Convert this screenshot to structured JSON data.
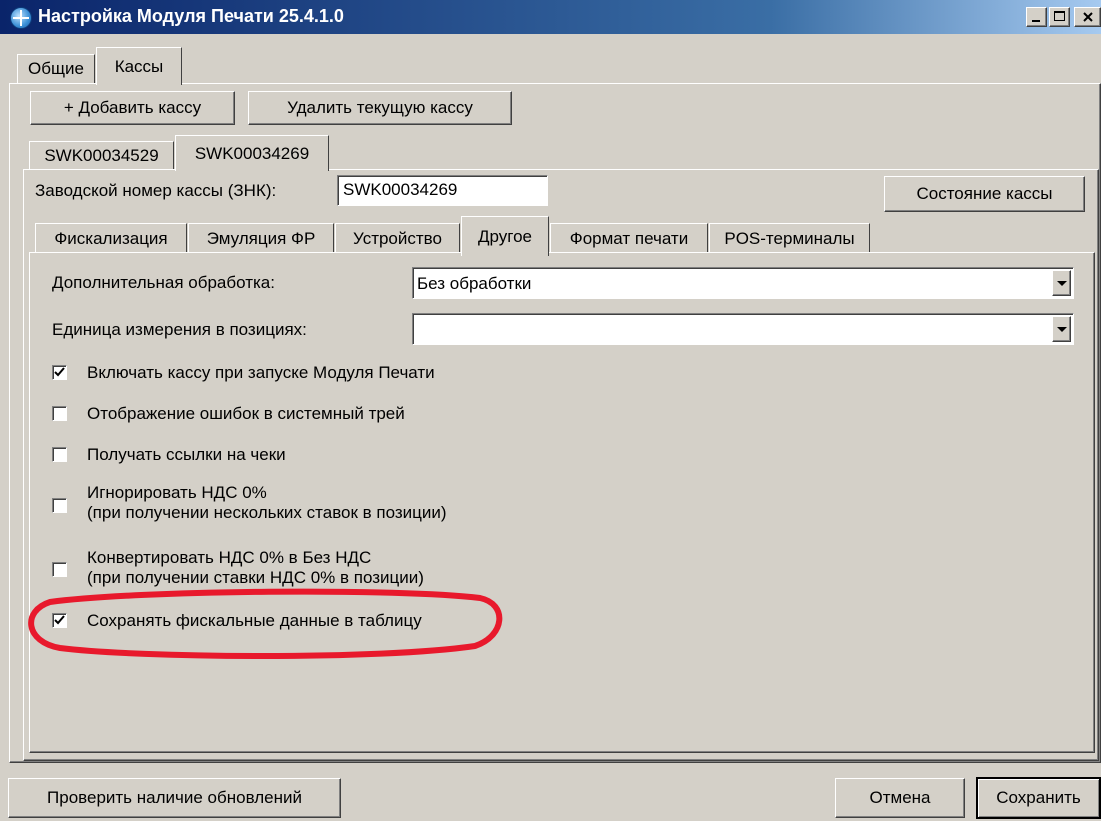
{
  "window": {
    "title": "Настройка Модуля Печати 25.4.1.0",
    "icon": "app-globe-icon"
  },
  "top_tabs": [
    {
      "label": "Общие",
      "selected": false
    },
    {
      "label": "Кассы",
      "selected": true
    }
  ],
  "toolbar": {
    "add_label": "+ Добавить кассу",
    "delete_label": "Удалить текущую кассу"
  },
  "register_tabs": [
    {
      "label": "SWK00034529",
      "selected": false
    },
    {
      "label": "SWK00034269",
      "selected": true
    }
  ],
  "serial": {
    "label": "Заводской номер кассы (ЗНК):",
    "value": "SWK00034269",
    "status_button": "Состояние кассы"
  },
  "settings_tabs": [
    {
      "label": "Фискализация",
      "selected": false
    },
    {
      "label": "Эмуляция ФР",
      "selected": false
    },
    {
      "label": "Устройство",
      "selected": false
    },
    {
      "label": "Другое",
      "selected": true
    },
    {
      "label": "Формат печати",
      "selected": false
    },
    {
      "label": "POS-терминалы",
      "selected": false
    }
  ],
  "other": {
    "processing_label": "Дополнительная обработка:",
    "processing_value": "Без обработки",
    "unit_label": "Единица измерения в позициях:",
    "unit_value": "",
    "checkboxes": [
      {
        "line1": "Включать кассу при запуске Модуля Печати",
        "line2": "",
        "checked": true
      },
      {
        "line1": "Отображение ошибок в системный трей",
        "line2": "",
        "checked": false
      },
      {
        "line1": "Получать ссылки на чеки",
        "line2": "",
        "checked": false
      },
      {
        "line1": "Игнорировать НДС 0%",
        "line2": "(при получении нескольких ставок в позиции)",
        "checked": false
      },
      {
        "line1": "Конвертировать НДС 0% в Без НДС",
        "line2": "(при получении ставки НДС 0% в позиции)",
        "checked": false
      },
      {
        "line1": "Сохранять фискальные данные в таблицу",
        "line2": "",
        "checked": true
      }
    ],
    "highlight_color": "#e8192c"
  },
  "footer": {
    "check_updates": "Проверить наличие обновлений",
    "cancel": "Отмена",
    "save": "Сохранить"
  }
}
